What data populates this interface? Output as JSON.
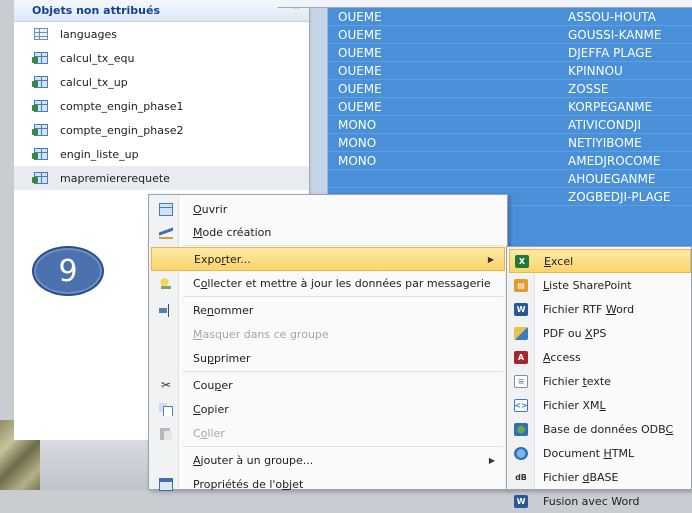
{
  "nav": {
    "group_title": "Objets non attribués",
    "collapse_glyph": "⌃",
    "items": [
      {
        "label": "languages",
        "icon": "table-icon"
      },
      {
        "label": "calcul_tx_equ",
        "icon": "query-icon"
      },
      {
        "label": "calcul_tx_up",
        "icon": "query-icon"
      },
      {
        "label": "compte_engin_phase1",
        "icon": "query-icon"
      },
      {
        "label": "compte_engin_phase2",
        "icon": "query-icon"
      },
      {
        "label": "engin_liste_up",
        "icon": "query-icon"
      },
      {
        "label": "mapremiererequete",
        "icon": "query-icon"
      }
    ]
  },
  "grid": {
    "rows": [
      {
        "c1": "OUEME",
        "c2": "ASSOU-HOUTA"
      },
      {
        "c1": "OUEME",
        "c2": "GOUSSI-KANME"
      },
      {
        "c1": "OUEME",
        "c2": "DJEFFA PLAGE"
      },
      {
        "c1": "OUEME",
        "c2": "KPINNOU"
      },
      {
        "c1": "OUEME",
        "c2": "ZOSSE"
      },
      {
        "c1": "OUEME",
        "c2": "KORPEGANME"
      },
      {
        "c1": "MONO",
        "c2": "ATIVICONDJI"
      },
      {
        "c1": "MONO",
        "c2": "NETIYIBOME"
      },
      {
        "c1": "MONO",
        "c2": "AMEDJROCOME"
      },
      {
        "c1": "",
        "c2": "AHOUEGANME"
      },
      {
        "c1": "",
        "c2": "ZOGBEDJI-PLAGE"
      }
    ]
  },
  "badge": {
    "number": "9"
  },
  "context_menu": {
    "open": {
      "pre": "",
      "key": "O",
      "post": "uvrir"
    },
    "design": {
      "pre": "",
      "key": "M",
      "post": "ode création"
    },
    "export": {
      "pre": "Expo",
      "key": "r",
      "post": "ter..."
    },
    "collect": {
      "pre": "C",
      "key": "o",
      "post": "llecter et mettre à jour les données par messagerie"
    },
    "rename": {
      "pre": "Re",
      "key": "n",
      "post": "ommer"
    },
    "hide": {
      "pre": "",
      "key": "M",
      "post": "asquer dans ce groupe"
    },
    "delete": {
      "pre": "Su",
      "key": "p",
      "post": "primer"
    },
    "cut": {
      "pre": "Cou",
      "key": "p",
      "post": "er"
    },
    "copy": {
      "pre": "",
      "key": "C",
      "post": "opier"
    },
    "paste": {
      "pre": "C",
      "key": "o",
      "post": "ller"
    },
    "add_group": {
      "pre": "",
      "key": "A",
      "post": "jouter à un groupe..."
    },
    "properties": {
      "pre": "Propriétés de l'o",
      "key": "b",
      "post": "jet"
    }
  },
  "export_submenu": {
    "excel": {
      "pre": "",
      "key": "E",
      "post": "xcel"
    },
    "sharepoint": {
      "pre": "",
      "key": "L",
      "post": "iste SharePoint"
    },
    "rtf": {
      "pre": "Fichier RTF ",
      "key": "W",
      "post": "ord"
    },
    "pdf": {
      "pre": "PDF ou ",
      "key": "X",
      "post": "PS"
    },
    "access": {
      "pre": "",
      "key": "A",
      "post": "ccess"
    },
    "text": {
      "pre": "Fichier ",
      "key": "t",
      "post": "exte"
    },
    "xml": {
      "pre": "Fichier XM",
      "key": "L",
      "post": ""
    },
    "odbc": {
      "pre": "Base de données ODB",
      "key": "C",
      "post": ""
    },
    "html": {
      "pre": "Document ",
      "key": "H",
      "post": "TML"
    },
    "dbase": {
      "pre": "Fichier ",
      "key": "d",
      "post": "BASE"
    },
    "word_merge": {
      "pre": "Fusion avec Word",
      "key": "",
      "post": ""
    }
  },
  "colors": {
    "highlight": "#fbd56c",
    "grid_selection": "#4a90d9",
    "nav_title": "#15428b",
    "badge": "#4b71ae"
  }
}
